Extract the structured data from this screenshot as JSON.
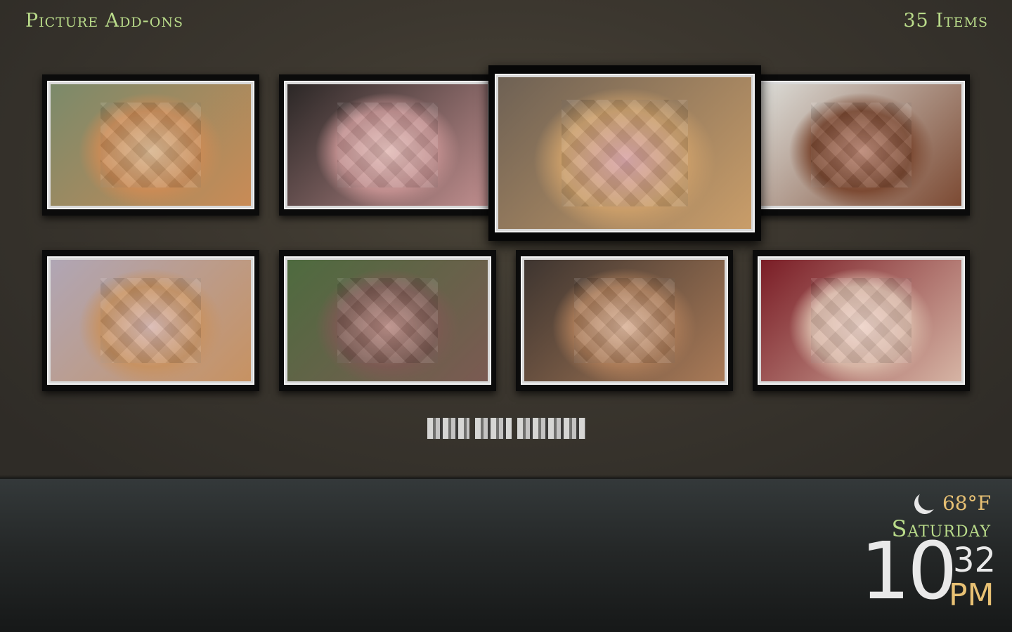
{
  "header": {
    "title": "Picture Add-ons",
    "item_count": "35 Items"
  },
  "grid": {
    "items": [
      {
        "label": "",
        "thumbnail_colors": [
          "#7b8a6a",
          "#c98b56",
          "#d7b48d"
        ]
      },
      {
        "label": "",
        "thumbnail_colors": [
          "#2b2726",
          "#c08e8e",
          "#e2bbb7"
        ]
      },
      {
        "label": "",
        "thumbnail_colors": [
          "#6e6154",
          "#c99d69",
          "#d8a3a6"
        ],
        "focused": true
      },
      {
        "label": "",
        "thumbnail_colors": [
          "#dcdcd7",
          "#7c4a33",
          "#b98471"
        ]
      },
      {
        "label": "",
        "thumbnail_colors": [
          "#b0a6b5",
          "#c79262",
          "#d7b6b0"
        ]
      },
      {
        "label": "",
        "thumbnail_colors": [
          "#4e6b3f",
          "#7b5a52",
          "#b98b84"
        ]
      },
      {
        "label": "",
        "thumbnail_colors": [
          "#3e3530",
          "#a97a57",
          "#dab399"
        ]
      },
      {
        "label": "",
        "thumbnail_colors": [
          "#7a1d26",
          "#d6b4a4",
          "#ecd1c6"
        ]
      }
    ]
  },
  "weather": {
    "icon": "moon-icon",
    "temperature": "68°F"
  },
  "clock": {
    "day": "Saturday",
    "hour": "10",
    "minute": "32",
    "ampm": "PM"
  },
  "colors": {
    "accent_green": "#b9db8a",
    "accent_gold": "#e8c174",
    "clock_white": "#e9e9e9"
  }
}
